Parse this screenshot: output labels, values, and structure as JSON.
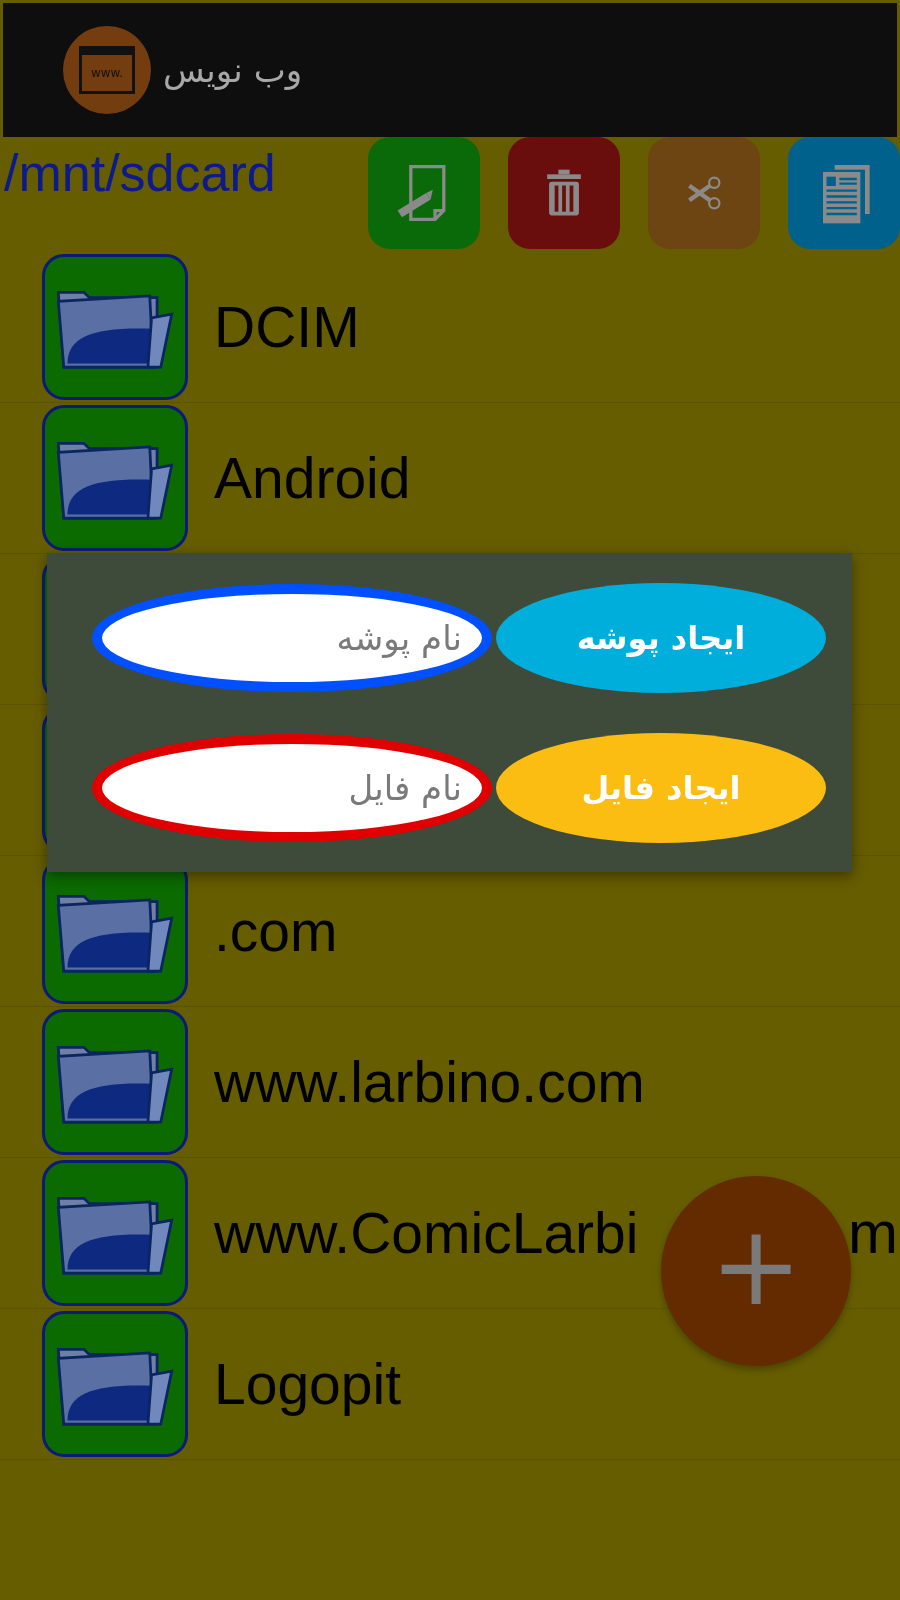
{
  "app_bar": {
    "logo_text": "www.",
    "title": "وب نویس"
  },
  "path": "/mnt/sdcard",
  "toolbar": [
    {
      "kind": "new"
    },
    {
      "kind": "delete"
    },
    {
      "kind": "cut"
    },
    {
      "kind": "copy"
    }
  ],
  "files": [
    {
      "kind": "folder",
      "name": "DCIM"
    },
    {
      "kind": "folder",
      "name": "Android"
    },
    {
      "kind": "folder"
    },
    {
      "kind": "folder"
    },
    {
      "kind": "folder",
      "name": ".com"
    },
    {
      "kind": "folder",
      "name": "www.larbino.com"
    },
    {
      "kind": "folder",
      "name": "www.ComicLarbi",
      "name_end": "m"
    },
    {
      "kind": "folder",
      "name": "Logopit"
    }
  ],
  "dialog": {
    "rows": [
      {
        "field": {
          "placeholder": "نام پوشه",
          "color": "#0050ff"
        },
        "button": {
          "label": "ایجاد پوشه",
          "color": "#00aedb"
        }
      },
      {
        "field": {
          "placeholder": "نام فایل",
          "color": "#e00000"
        },
        "button": {
          "label": "ایجاد فایل",
          "color": "#fbbd12"
        }
      }
    ]
  },
  "fab": {
    "label": "+"
  }
}
